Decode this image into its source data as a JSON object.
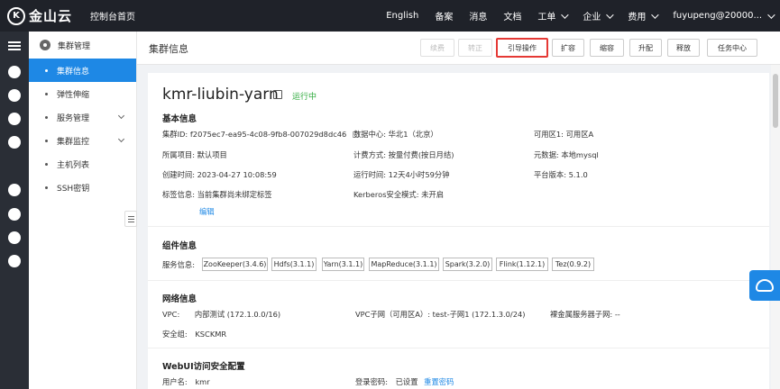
{
  "topbar": {
    "logo_mark": "K",
    "logo_text": "金山云",
    "console_home": "控制台首页",
    "nav": [
      "English",
      "备案",
      "消息",
      "文档"
    ],
    "nav_dropdowns": [
      "工单",
      "企业",
      "费用"
    ],
    "user": "fuyupeng@20000..."
  },
  "sidebar": {
    "header": "集群管理",
    "items": [
      {
        "label": "集群信息"
      },
      {
        "label": "弹性伸缩"
      },
      {
        "label": "服务管理"
      },
      {
        "label": "集群监控"
      },
      {
        "label": "主机列表"
      },
      {
        "label": "SSH密钥"
      }
    ]
  },
  "page": {
    "title": "集群信息",
    "buttons": [
      "续费",
      "转正",
      "引导操作",
      "扩容",
      "缩容",
      "升配",
      "释放",
      "任务中心"
    ]
  },
  "cluster": {
    "name": "kmr-liubin-yarn",
    "status": "运行中",
    "basic": {
      "title": "基本信息",
      "id_label": "集群ID:",
      "id_value": "f2075ec7-ea95-4c08-9fb8-007029d8dc46",
      "dc_label": "数据中心:",
      "dc_value": "华北1（北京）",
      "az_label": "可用区1:",
      "az_value": "可用区A",
      "project_label": "所属项目:",
      "project_value": "默认项目",
      "billing_label": "计费方式:",
      "billing_value": "按量付费(按日月结)",
      "meta_label": "元数据:",
      "meta_value": "本地mysql",
      "created_label": "创建时间:",
      "created_value": "2023-04-27 10:08:59",
      "uptime_label": "运行时间:",
      "uptime_value": "12天4小时59分钟",
      "platform_label": "平台版本:",
      "platform_value": "5.1.0",
      "tag_label": "标签信息:",
      "tag_value": "当前集群尚未绑定标签",
      "kerberos_label": "Kerberos安全模式:",
      "kerberos_value": "未开启",
      "edit_link": "编辑"
    },
    "components": {
      "title": "组件信息",
      "label": "服务信息:",
      "tags": [
        "ZooKeeper(3.4.6)",
        "Hdfs(3.1.1)",
        "Yarn(3.1.1)",
        "MapReduce(3.1.1)",
        "Spark(3.2.0)",
        "Flink(1.12.1)",
        "Tez(0.9.2)"
      ]
    },
    "network": {
      "title": "网络信息",
      "vpc_label": "VPC:",
      "vpc_value": "内部测试 (172.1.0.0/16)",
      "subnet_label": "VPC子网（可用区A）:",
      "subnet_value": "test-子网1 (172.1.3.0/24)",
      "baremetal_label": "裸金属服务器子网:",
      "baremetal_value": "--",
      "sg_label": "安全组:",
      "sg_value": "KSCKMR"
    },
    "webui": {
      "title": "WebUI访问安全配置",
      "user_label": "用户名:",
      "user_value": "kmr",
      "pwd_label": "登录密码:",
      "pwd_value": "已设置",
      "reset_link": "重置密码"
    }
  }
}
